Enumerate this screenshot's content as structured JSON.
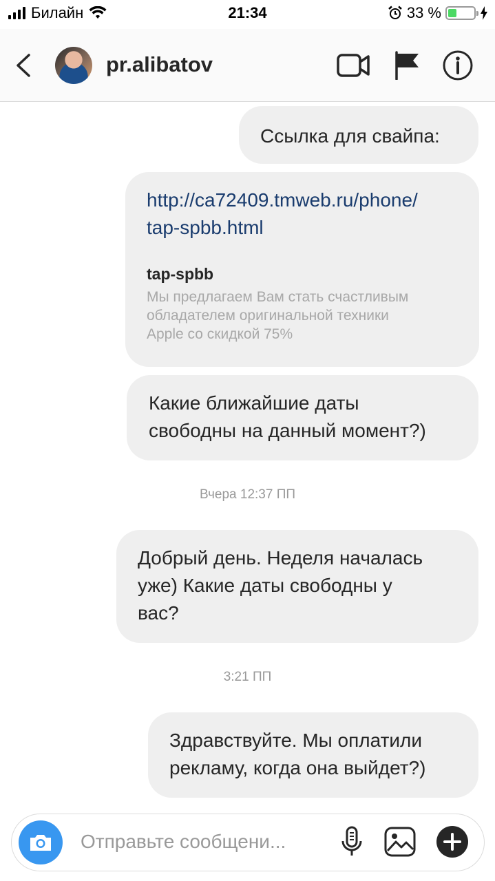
{
  "status_bar": {
    "carrier": "Билайн",
    "time": "21:34",
    "battery_percent": "33 %",
    "battery_level": 0.33,
    "icons": [
      "signal-icon",
      "wifi-icon",
      "alarm-icon",
      "battery-icon",
      "charging-icon"
    ]
  },
  "header": {
    "username": "pr.alibatov",
    "icons": [
      "back-icon",
      "video-call-icon",
      "flag-icon",
      "info-icon"
    ]
  },
  "messages": [
    {
      "text": "Ссылка для свайпа:"
    },
    {
      "link_url_line1": "http://ca72409.tmweb.ru/phone/",
      "link_url_line2": "tap-spbb.html",
      "link_title": "tap-spbb",
      "link_desc_line1": "Мы предлагаем Вам стать счастливым",
      "link_desc_line2": "обладателем оригинальной техники",
      "link_desc_line3": "Apple со скидкой 75%"
    },
    {
      "line1": "Какие ближайшие даты",
      "line2": "свободны на данный момент?)"
    },
    {
      "line1": "Добрый день. Неделя началась",
      "line2": "уже) Какие даты свободны у",
      "line3": "вас?"
    },
    {
      "line1": "Здравствуйте. Мы оплатили",
      "line2": "рекламу, когда она выйдет?)"
    }
  ],
  "timestamps": [
    "Вчера 12:37 ПП",
    "3:21 ПП"
  ],
  "composer": {
    "placeholder": "Отправьте сообщени...",
    "icons": [
      "camera-icon",
      "microphone-icon",
      "gallery-icon",
      "plus-icon"
    ]
  },
  "colors": {
    "bubble": "#efefef",
    "link": "#1a3c6e",
    "camera_button": "#3897f0",
    "battery": "#4cd964"
  }
}
